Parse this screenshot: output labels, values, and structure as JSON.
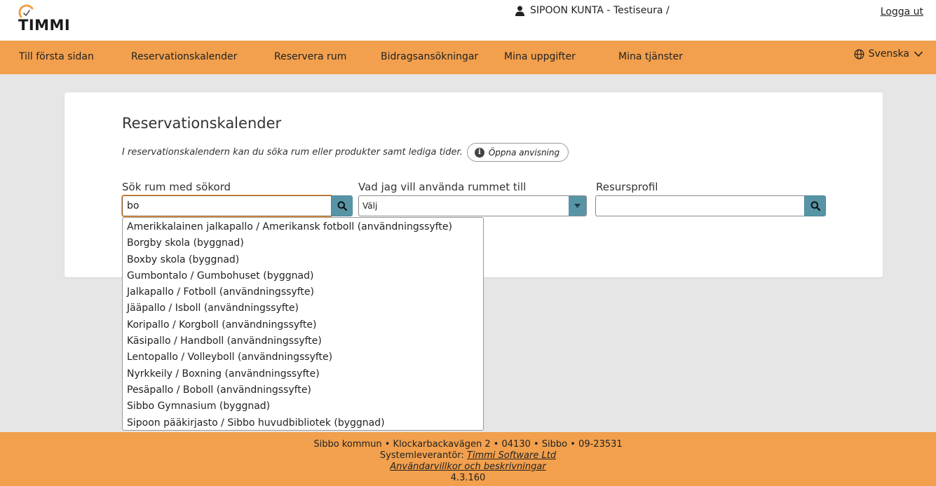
{
  "header": {
    "logo_text": "TIMMI",
    "user": "SIPOON KUNTA - Testiseura /",
    "logout_label": "Logga ut"
  },
  "nav": {
    "items": [
      "Till första sidan",
      "Reservationskalender",
      "Reservera rum",
      "Bidragsansökningar",
      "Mina uppgifter",
      "Mina tjänster"
    ],
    "language": "Svenska"
  },
  "main": {
    "title": "Reservationskalender",
    "intro": "I reservationskalendern kan du söka rum eller produkter samt lediga tider.",
    "guide_button": "Öppna anvisning",
    "search_label": "Sök rum med sökord",
    "search_value": "bo",
    "usage_label": "Vad jag vill använda rummet till",
    "usage_value": "Välj",
    "profile_label": "Resursprofil",
    "profile_value": ""
  },
  "dropdown": {
    "items": [
      "Amerikkalainen jalkapallo / Amerikansk fotboll (användningssyfte)",
      "Borgby skola (byggnad)",
      "Boxby skola (byggnad)",
      "Gumbontalo / Gumbohuset (byggnad)",
      "Jalkapallo / Fotboll (användningssyfte)",
      "Jääpallo / Isboll (användningssyfte)",
      "Koripallo / Korgboll (användningssyfte)",
      "Käsipallo / Handboll (användningssyfte)",
      "Lentopallo / Volleyboll (användningssyfte)",
      "Nyrkkeily / Boxning (användningssyfte)",
      "Pesäpallo / Boboll (användningssyfte)",
      "Sibbo Gymnasium (byggnad)",
      "Sipoon pääkirjasto / Sibbo huvudbibliotek (byggnad)"
    ]
  },
  "footer": {
    "address": "Sibbo kommun • Klockarbackavägen 2 • 04130 • Sibbo • 09-23531",
    "supplier_label": "Systemleverantör:",
    "supplier_link": "Timmi Software Ltd",
    "terms_link": "Användarvillkor och beskrivningar",
    "version": "4.3.160"
  },
  "colors": {
    "accent": "#f2a04d",
    "button": "#5795a6",
    "background": "#e6e6e6"
  }
}
